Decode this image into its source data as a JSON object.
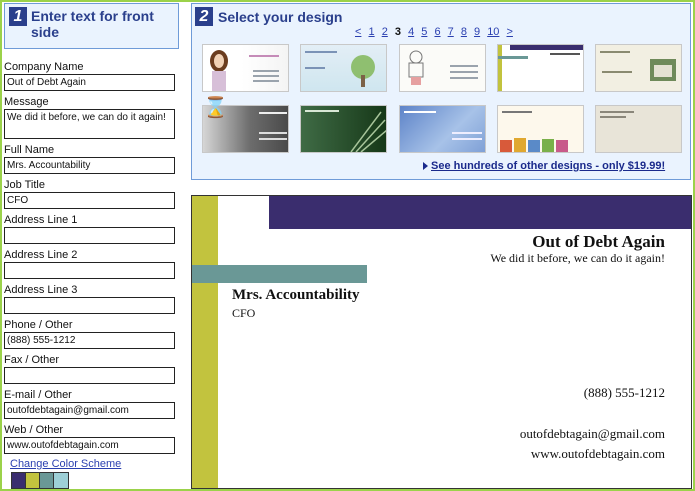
{
  "step1": {
    "number": "1",
    "title": "Enter text for front side"
  },
  "form": {
    "company": {
      "label": "Company Name",
      "value": "Out of Debt Again"
    },
    "message": {
      "label": "Message",
      "value": "We did it before, we can do it again!"
    },
    "fullname": {
      "label": "Full Name",
      "value": "Mrs. Accountability"
    },
    "jobtitle": {
      "label": "Job Title",
      "value": "CFO"
    },
    "address1": {
      "label": "Address Line 1",
      "value": ""
    },
    "address2": {
      "label": "Address Line 2",
      "value": ""
    },
    "address3": {
      "label": "Address Line 3",
      "value": ""
    },
    "phone": {
      "label": "Phone / Other",
      "value": "(888) 555-1212"
    },
    "fax": {
      "label": "Fax / Other",
      "value": ""
    },
    "email": {
      "label": "E-mail / Other",
      "value": "outofdebtagain@gmail.com"
    },
    "web": {
      "label": "Web / Other",
      "value": "www.outofdebtagain.com"
    }
  },
  "color_scheme": {
    "link": "Change Color Scheme",
    "swatches": [
      "#3a2d6e",
      "#c2c33e",
      "#6a9896",
      "#9ed0d6"
    ]
  },
  "step2": {
    "number": "2",
    "title": "Select your design",
    "pager": {
      "prev": "<",
      "pages": [
        "1",
        "2",
        "3",
        "4",
        "5",
        "6",
        "7",
        "8",
        "9",
        "10"
      ],
      "current": "3",
      "next": ">"
    },
    "more_link": "See hundreds of other designs - only $19.99!"
  },
  "card": {
    "company": "Out of Debt Again",
    "message": "We did it before, we can do it again!",
    "name": "Mrs. Accountability",
    "title": "CFO",
    "phone": "(888) 555-1212",
    "email": "outofdebtagain@gmail.com",
    "web": "www.outofdebtagain.com",
    "colors": {
      "olive": "#c2c33e",
      "purple": "#3a2d6e",
      "teal": "#6a9896"
    }
  }
}
